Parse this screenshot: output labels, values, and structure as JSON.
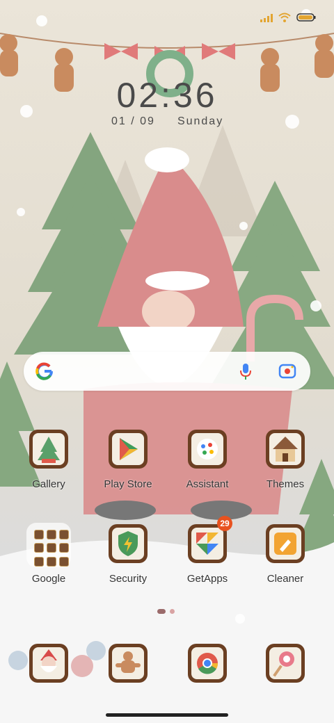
{
  "status_bar": {
    "icons": [
      "signal-icon",
      "wifi-icon",
      "battery-icon"
    ],
    "battery_color": "#e3a531"
  },
  "lock_clock": {
    "time": "02:36",
    "date": "01 / 09",
    "weekday": "Sunday"
  },
  "search": {
    "icons": [
      "google-g-icon",
      "microphone-icon",
      "lens-camera-icon"
    ]
  },
  "apps": [
    {
      "label": "Gallery",
      "icon": "gallery-tree-icon"
    },
    {
      "label": "Play Store",
      "icon": "play-store-icon"
    },
    {
      "label": "Assistant",
      "icon": "assistant-icon"
    },
    {
      "label": "Themes",
      "icon": "themes-house-icon"
    },
    {
      "label": "Google",
      "icon": "google-folder-icon"
    },
    {
      "label": "Security",
      "icon": "security-shield-icon"
    },
    {
      "label": "GetApps",
      "icon": "getapps-icon",
      "badge": "29"
    },
    {
      "label": "Cleaner",
      "icon": "cleaner-brush-icon"
    }
  ],
  "dock": [
    {
      "icon": "santa-phone-icon"
    },
    {
      "icon": "gingerbread-messages-icon"
    },
    {
      "icon": "chrome-icon"
    },
    {
      "icon": "lollipop-camera-icon"
    }
  ],
  "page_indicator": {
    "pages": 2,
    "active": 0
  },
  "colors": {
    "wallpaper": "#e6e0d4",
    "icon_frame": "#6b3f22",
    "badge": "#e8521f",
    "text": "#333333"
  }
}
